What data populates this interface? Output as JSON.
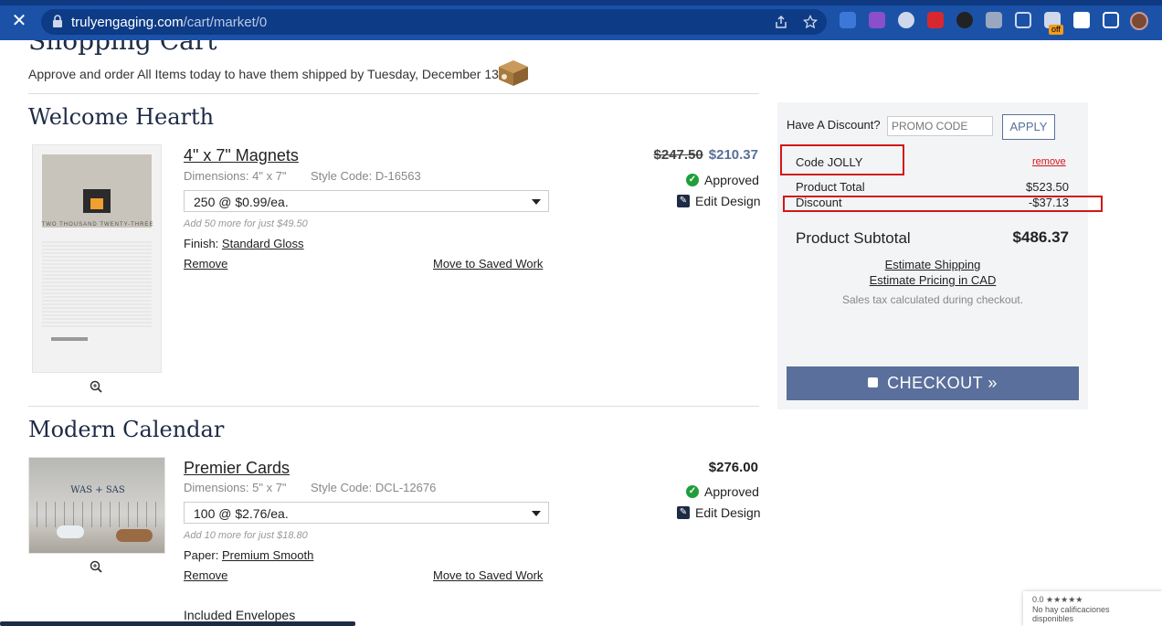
{
  "browser": {
    "url_domain": "trulyengaging.com",
    "url_path": "/cart/market/0",
    "ext_badge": "off"
  },
  "page": {
    "title": "Shopping Cart",
    "ship_note": "Approve and order All Items today to have them shipped by Tuesday, December 13"
  },
  "items": [
    {
      "section": "Welcome Hearth",
      "name": "4\" x 7\" Magnets",
      "dimensions": "Dimensions: 4\" x 7\"",
      "style_code": "Style Code: D-16563",
      "quantity": "250 @ $0.99/ea.",
      "add_more": "Add 50 more for just $49.50",
      "option_label": "Finish:",
      "option_value": "Standard Gloss",
      "remove": "Remove",
      "move": "Move to Saved Work",
      "old_price": "$247.50",
      "price": "$210.37",
      "status": "Approved",
      "edit": "Edit Design",
      "thumb_caption": "TWO THOUSAND TWENTY-THREE"
    },
    {
      "section": "Modern Calendar",
      "name": "Premier Cards",
      "dimensions": "Dimensions: 5\" x 7\"",
      "style_code": "Style Code: DCL-12676",
      "quantity": "100 @ $2.76/ea.",
      "add_more": "Add 10 more for just $18.80",
      "option_label": "Paper:",
      "option_value": "Premium Smooth",
      "remove": "Remove",
      "move": "Move to Saved Work",
      "price": "$276.00",
      "status": "Approved",
      "edit": "Edit Design",
      "thumb_caption": "WAS + SAS"
    }
  ],
  "included": "Included Envelopes",
  "summary": {
    "discount_label": "Have A Discount?",
    "promo_placeholder": "PROMO CODE",
    "apply": "APPLY",
    "code": "Code JOLLY",
    "remove": "remove",
    "product_total_label": "Product Total",
    "product_total": "$523.50",
    "discount_row_label": "Discount",
    "discount_value": "-$37.13",
    "subtotal_label": "Product Subtotal",
    "subtotal": "$486.37",
    "estimate_shipping": "Estimate Shipping",
    "estimate_cad": "Estimate Pricing in CAD",
    "tax_note": "Sales tax calculated during checkout.",
    "checkout": "CHECKOUT »"
  },
  "rating_widget": {
    "score": "0.0 ★★★★★",
    "text": "No hay calificaciones disponibles"
  }
}
